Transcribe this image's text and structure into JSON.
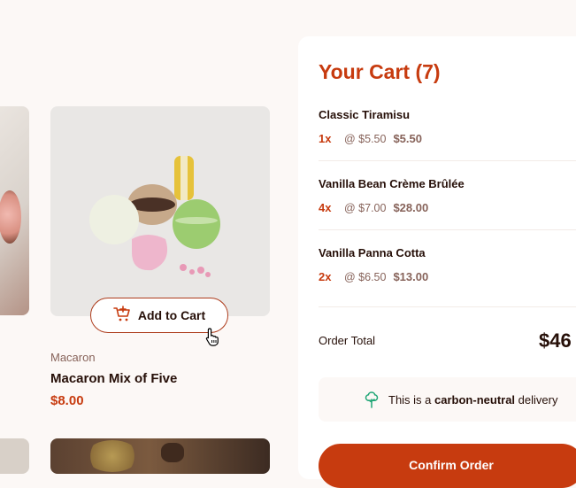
{
  "product": {
    "add_to_cart_label": "Add to Cart",
    "category": "Macaron",
    "name": "Macaron Mix of Five",
    "price": "$8.00"
  },
  "cart": {
    "title": "Your Cart (7)",
    "items": [
      {
        "name": "Classic Tiramisu",
        "qty": "1x",
        "unit_price": "@ $5.50",
        "total": "$5.50"
      },
      {
        "name": "Vanilla Bean Crème Brûlée",
        "qty": "4x",
        "unit_price": "@ $7.00",
        "total": "$28.00"
      },
      {
        "name": "Vanilla Panna Cotta",
        "qty": "2x",
        "unit_price": "@ $6.50",
        "total": "$13.00"
      }
    ],
    "order_total_label": "Order Total",
    "order_total": "$46",
    "carbon_prefix": "This is a",
    "carbon_bold": "carbon-neutral",
    "carbon_suffix": "delivery",
    "confirm_label": "Confirm Order"
  },
  "colors": {
    "accent": "#c73b0f",
    "text": "#260f08",
    "muted": "#87635a",
    "background": "#fcf8f6",
    "carbon_icon": "#1ea575"
  },
  "icons": {
    "add_to_cart": "cart-plus-icon",
    "cursor": "hand-pointer-icon",
    "carbon": "tree-icon"
  }
}
